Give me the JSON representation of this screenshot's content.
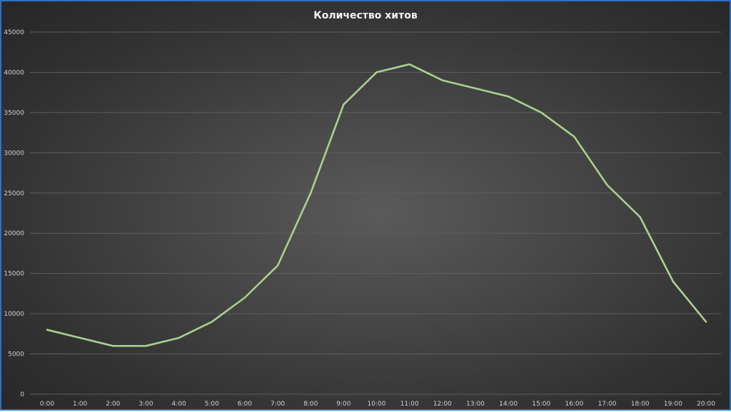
{
  "chart_data": {
    "type": "line",
    "title": "Количество хитов",
    "xlabel": "",
    "ylabel": "",
    "categories": [
      "0:00",
      "1:00",
      "2:00",
      "3:00",
      "4:00",
      "5:00",
      "6:00",
      "7:00",
      "8:00",
      "9:00",
      "10:00",
      "11:00",
      "12:00",
      "13:00",
      "14:00",
      "15:00",
      "16:00",
      "17:00",
      "18:00",
      "19:00",
      "20:00"
    ],
    "series": [
      {
        "values": [
          8000,
          7000,
          6000,
          6000,
          7000,
          9000,
          12000,
          16000,
          25000,
          36000,
          40000,
          41000,
          39000,
          38000,
          37000,
          35000,
          32000,
          26000,
          22000,
          14000,
          9000
        ],
        "color": "#a9d18e"
      }
    ],
    "ylim": [
      0,
      45000
    ],
    "yticks": [
      "0",
      "5000",
      "10000",
      "15000",
      "20000",
      "25000",
      "30000",
      "35000",
      "40000",
      "45000"
    ],
    "grid": true,
    "legend": "none"
  }
}
